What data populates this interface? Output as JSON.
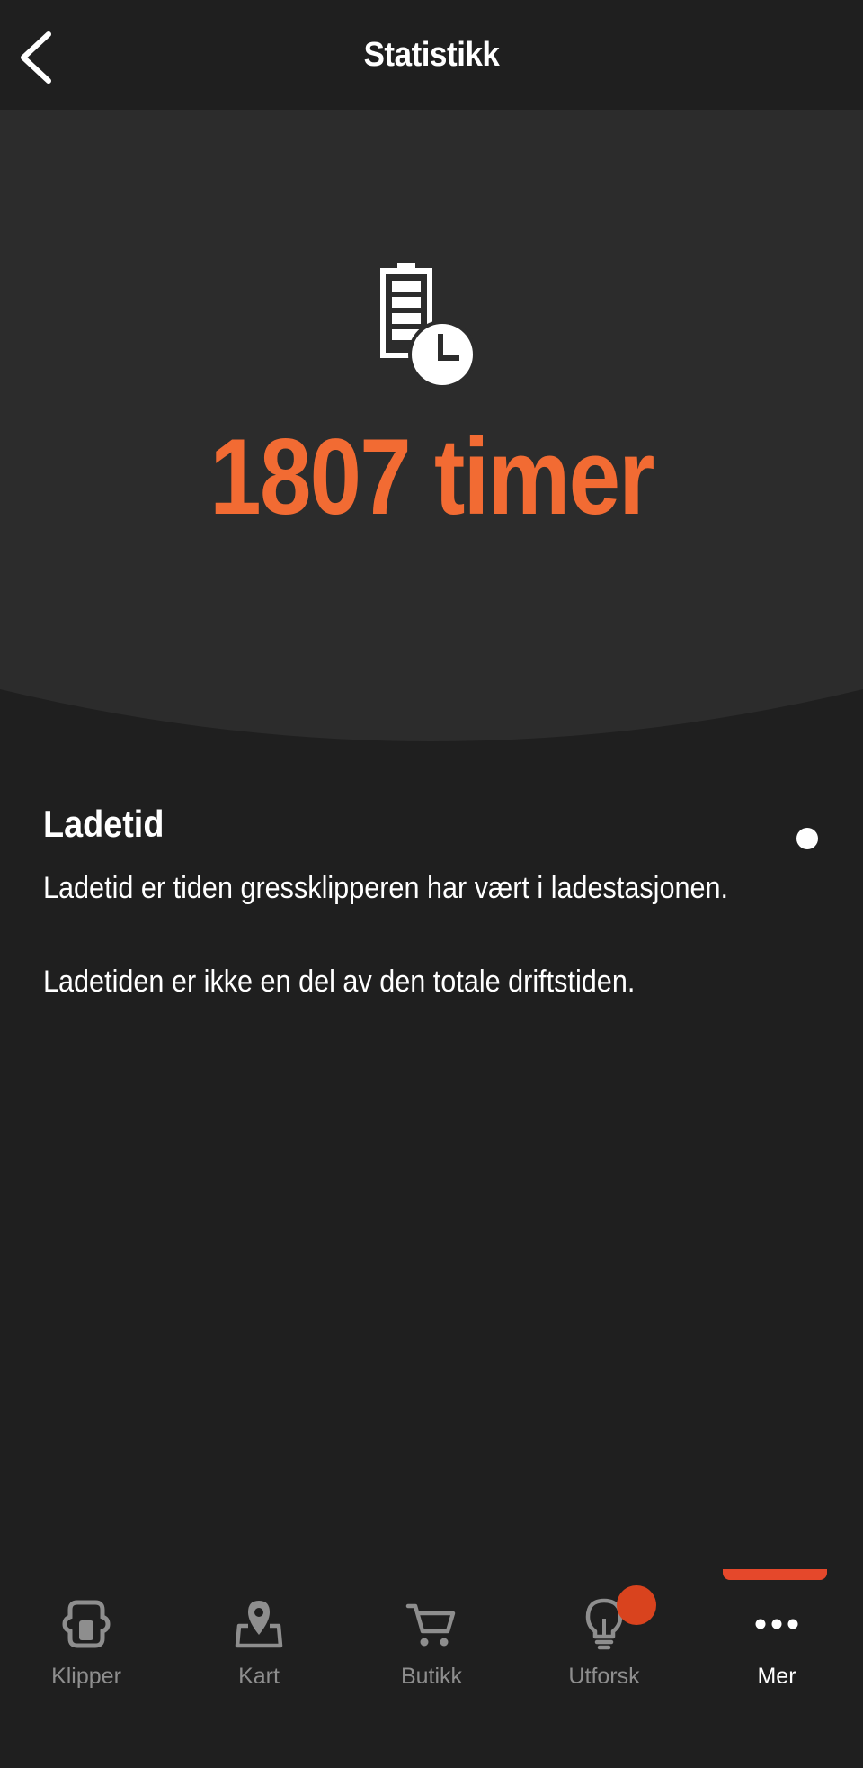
{
  "header": {
    "title": "Statistikk",
    "back_icon": "chevron-left-icon"
  },
  "hero": {
    "icon": "battery-clock-icon",
    "value": "1807 timer",
    "value_color": "#f26b33",
    "background_color": "#2c2c2c"
  },
  "info": {
    "title": "Ladetid",
    "paragraphs": [
      "Ladetid er tiden gressklipperen har vært i ladestasjonen.",
      "Ladetiden er ikke en del av den totale driftstiden."
    ]
  },
  "bottom_nav": {
    "items": [
      {
        "label": "Klipper",
        "icon": "mower-icon",
        "active": false
      },
      {
        "label": "Kart",
        "icon": "map-pin-icon",
        "active": false
      },
      {
        "label": "Butikk",
        "icon": "cart-icon",
        "active": false
      },
      {
        "label": "Utforsk",
        "icon": "lightbulb-icon",
        "active": false,
        "badge": true
      },
      {
        "label": "Mer",
        "icon": "more-dots-icon",
        "active": true
      }
    ],
    "accent_color": "#e5482b",
    "inactive_color": "#8e8e8e"
  }
}
